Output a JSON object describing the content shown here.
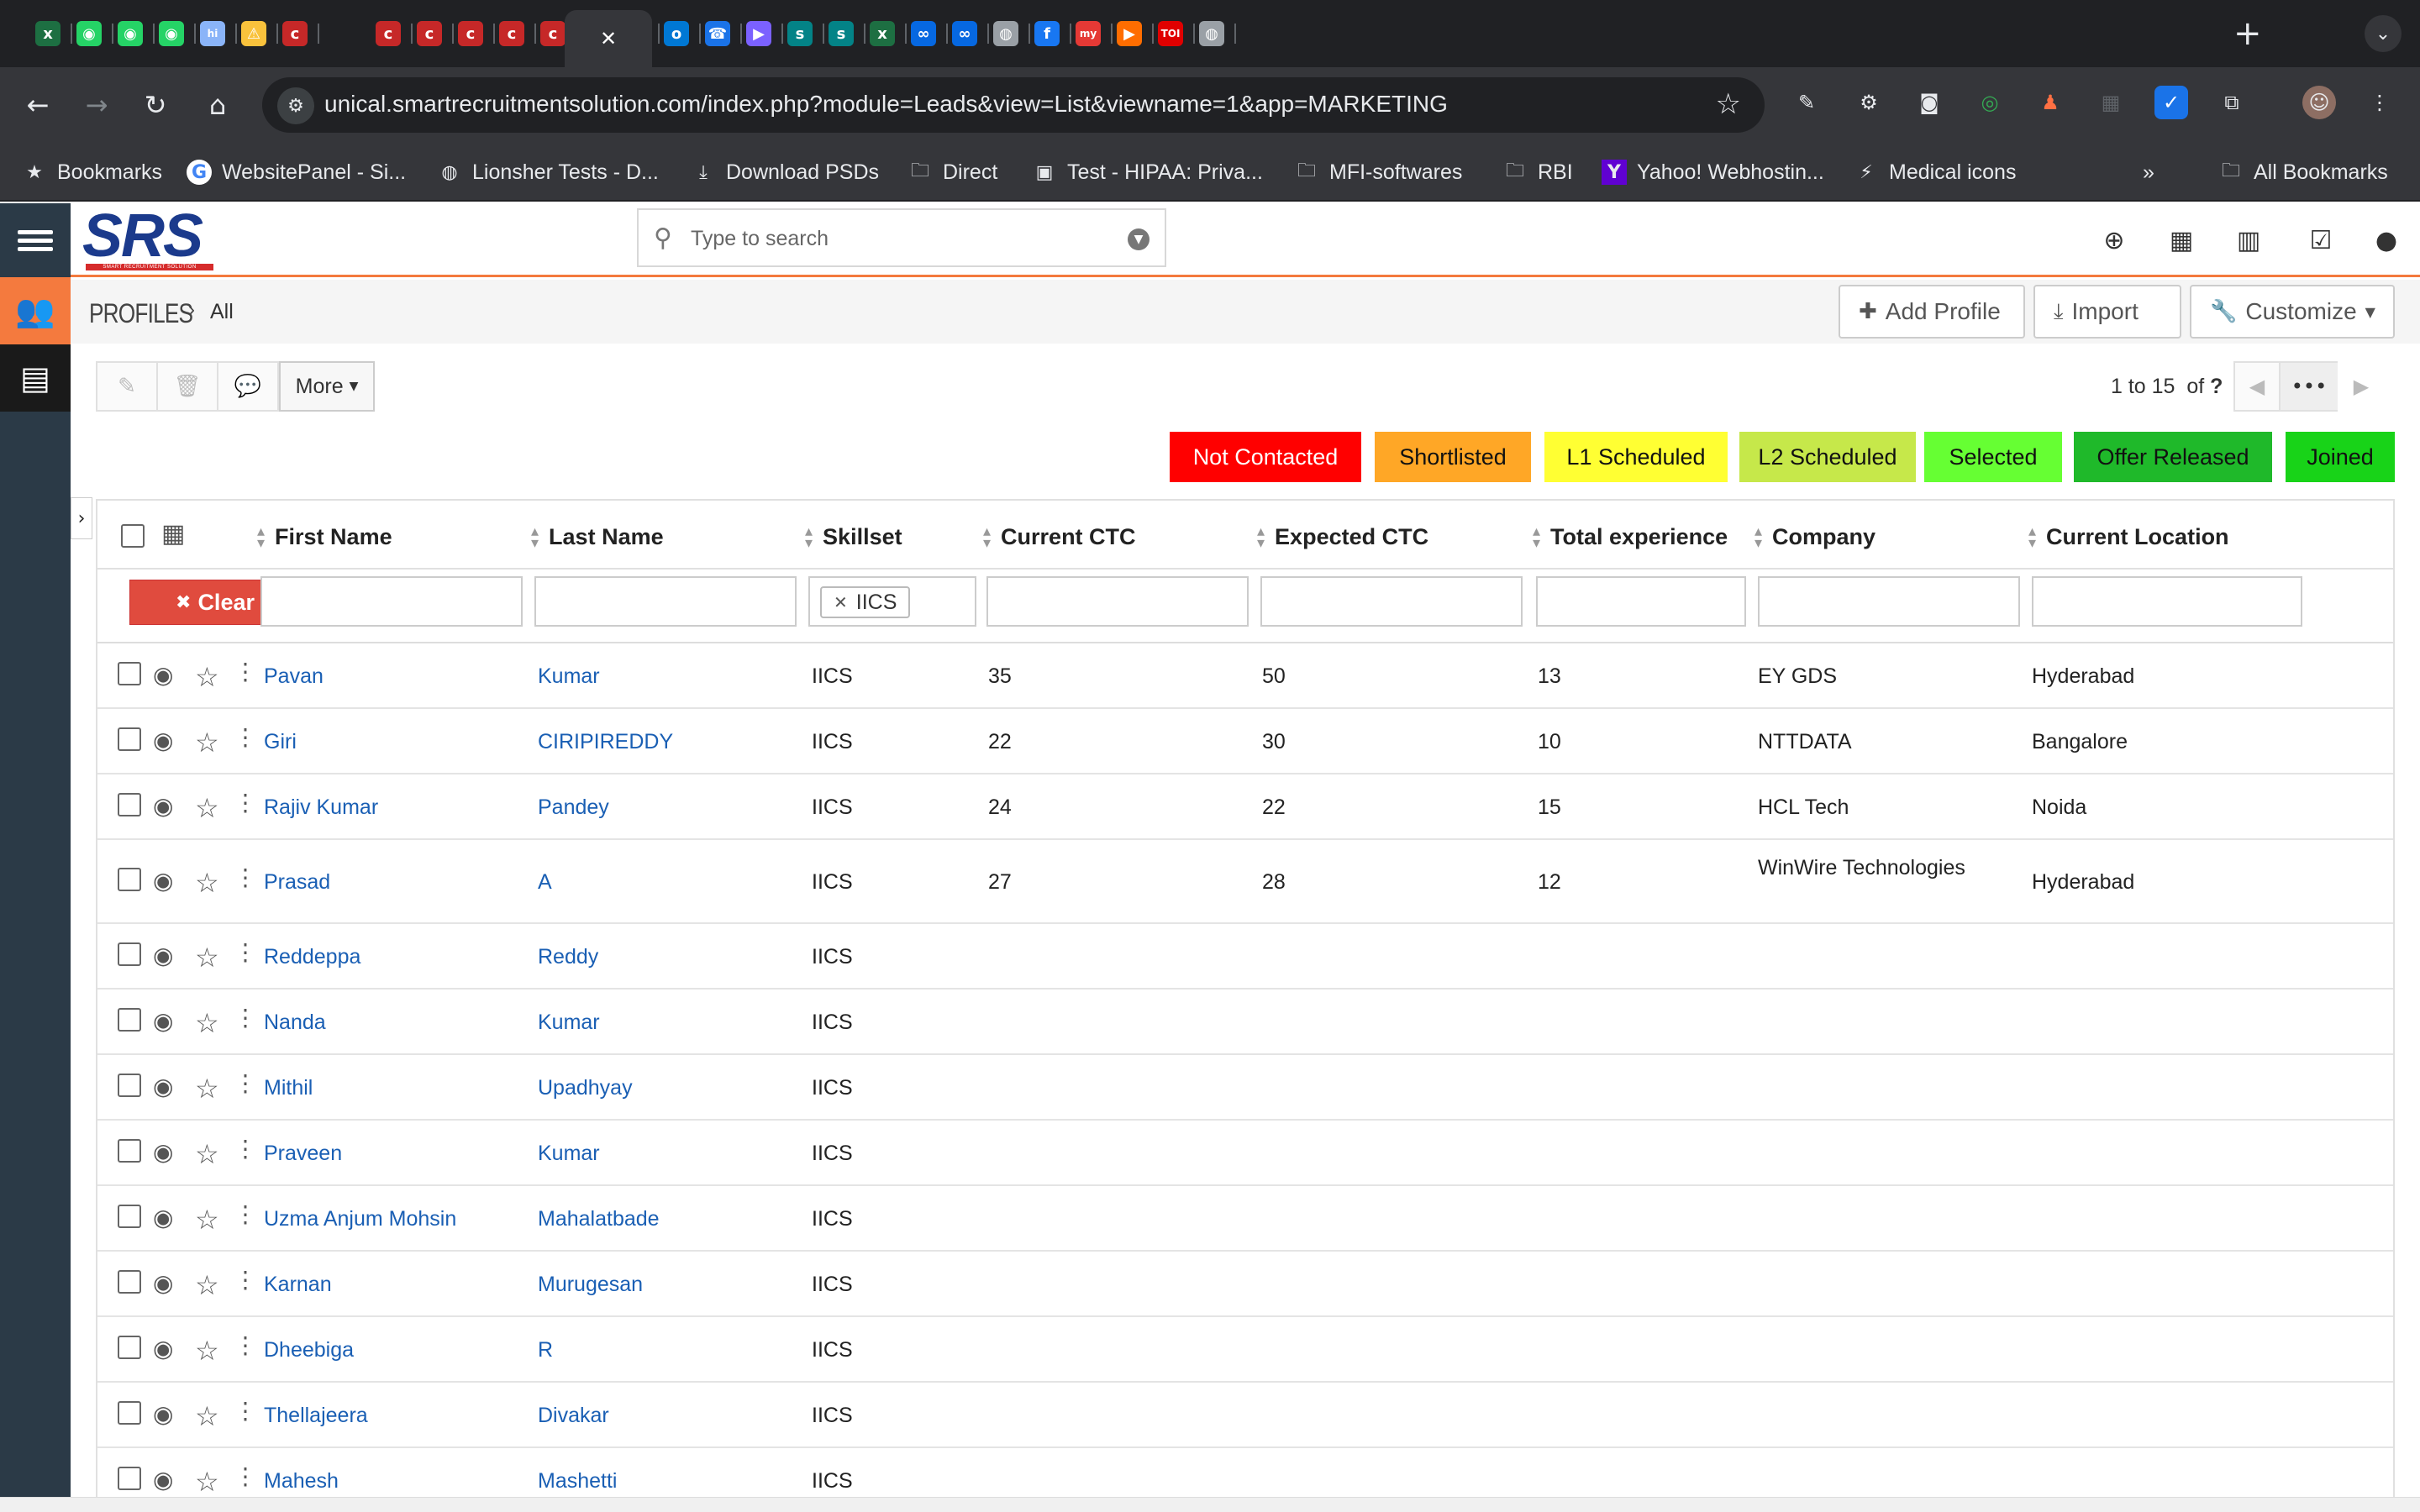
{
  "browser": {
    "tabs": [
      {
        "icon": "excel-icon",
        "glyph": "x",
        "color": "#1d6f42"
      },
      {
        "icon": "whatsapp-icon",
        "glyph": "◉",
        "color": "#25d366"
      },
      {
        "icon": "whatsapp-icon",
        "glyph": "◉",
        "color": "#25d366"
      },
      {
        "icon": "whatsapp-icon",
        "glyph": "◉",
        "color": "#25d366"
      },
      {
        "icon": "hi-icon",
        "glyph": "hi",
        "color": "#8ab4f8"
      },
      {
        "icon": "warning-app-icon",
        "glyph": "⚠",
        "color": "#f9c23c"
      },
      {
        "icon": "unical-icon",
        "glyph": "c",
        "color": "#c62828"
      },
      {
        "icon": "unical-icon",
        "glyph": "c",
        "color": "#c62828"
      },
      {
        "icon": "unical-icon",
        "glyph": "c",
        "color": "#c62828"
      },
      {
        "icon": "unical-icon",
        "glyph": "c",
        "color": "#c62828"
      },
      {
        "icon": "unical-icon",
        "glyph": "c",
        "color": "#c62828"
      },
      {
        "icon": "unical-icon",
        "glyph": "c",
        "color": "#c62828"
      },
      {
        "icon": "gmail-icon",
        "glyph": "M",
        "color": "#ea4335"
      },
      {
        "icon": "globe-green-icon",
        "glyph": "◍",
        "color": "#34a853"
      },
      {
        "icon": "outlook-icon",
        "glyph": "o",
        "color": "#0078d4"
      },
      {
        "icon": "phone-icon",
        "glyph": "☎",
        "color": "#1a73e8"
      },
      {
        "icon": "play-icon",
        "glyph": "▶",
        "color": "#7b61ff"
      },
      {
        "icon": "sharepoint-icon",
        "glyph": "s",
        "color": "#038387"
      },
      {
        "icon": "sharepoint-icon",
        "glyph": "s",
        "color": "#038387"
      },
      {
        "icon": "excel-icon",
        "glyph": "x",
        "color": "#1d6f42"
      },
      {
        "icon": "meta-icon",
        "glyph": "∞",
        "color": "#0668e1"
      },
      {
        "icon": "meta-icon",
        "glyph": "∞",
        "color": "#0668e1"
      },
      {
        "icon": "globe-icon",
        "glyph": "◍",
        "color": "#9aa0a6"
      },
      {
        "icon": "facebook-icon",
        "glyph": "f",
        "color": "#1877f2"
      },
      {
        "icon": "my-icon",
        "glyph": "my",
        "color": "#e53935"
      },
      {
        "icon": "arrow-app-icon",
        "glyph": "▶",
        "color": "#ff6d00"
      },
      {
        "icon": "toi-icon",
        "glyph": "TOI",
        "color": "#e00000"
      },
      {
        "icon": "globe-icon",
        "glyph": "◍",
        "color": "#9aa0a6"
      }
    ],
    "active_tab_close": "✕",
    "new_tab": "+",
    "url": "unical.smartrecruitmentsolution.com/index.php?module=Leads&view=List&viewname=1&app=MARKETING",
    "bookmarks": [
      {
        "icon": "star-icon",
        "glyph": "★",
        "label": "Bookmarks"
      },
      {
        "icon": "google-icon",
        "glyph": "G",
        "label": "WebsitePanel - Si..."
      },
      {
        "icon": "globe-icon",
        "glyph": "◍",
        "label": "Lionsher Tests - D..."
      },
      {
        "icon": "download-icon",
        "glyph": "⤓",
        "label": "Download PSDs"
      },
      {
        "icon": "folder-icon",
        "glyph": "🗀",
        "label": "Direct"
      },
      {
        "icon": "hipaa-icon",
        "glyph": "▣",
        "label": "Test - HIPAA: Priva..."
      },
      {
        "icon": "folder-icon",
        "glyph": "🗀",
        "label": "MFI-softwares"
      },
      {
        "icon": "folder-icon",
        "glyph": "🗀",
        "label": "RBI"
      },
      {
        "icon": "yahoo-icon",
        "glyph": "Y",
        "label": "Yahoo! Webhostin..."
      },
      {
        "icon": "lightning-icon",
        "glyph": "⚡",
        "label": "Medical icons"
      }
    ],
    "more_bookmarks": "»",
    "all_bookmarks": "All Bookmarks"
  },
  "app": {
    "logo_text": "SRS",
    "logo_tagline": "SMART RECRUITMENT SOLUTION",
    "search_placeholder": "Type to search",
    "module": "PROFILES",
    "view": "All",
    "buttons": {
      "add": "Add Profile",
      "import": "Import",
      "customize": "Customize"
    },
    "more": "More",
    "pager": {
      "range": "1 to 15",
      "of": "of",
      "total": "?"
    },
    "statuses": [
      {
        "label": "Not Contacted",
        "color": "#ff0000",
        "text": "#ffffff"
      },
      {
        "label": "Shortlisted",
        "color": "#ffa726",
        "text": "#111111"
      },
      {
        "label": "L1 Scheduled",
        "color": "#ffff33",
        "text": "#111111"
      },
      {
        "label": "L2 Scheduled",
        "color": "#c6e84a",
        "text": "#111111"
      },
      {
        "label": "Selected",
        "color": "#66ff33",
        "text": "#111111"
      },
      {
        "label": "Offer Released",
        "color": "#1fb92a",
        "text": "#111111"
      },
      {
        "label": "Joined",
        "color": "#18d318",
        "text": "#111111"
      }
    ],
    "columns": [
      "First Name",
      "Last Name",
      "Skillset",
      "Current CTC",
      "Expected CTC",
      "Total experience",
      "Company",
      "Current Location"
    ],
    "filter": {
      "clear": "Clear",
      "skillset_chip": "IICS"
    },
    "rows": [
      [
        "Pavan",
        "Kumar",
        "IICS",
        "35",
        "50",
        "13",
        "EY GDS",
        "Hyderabad"
      ],
      [
        "Giri",
        "CIRIPIREDDY",
        "IICS",
        "22",
        "30",
        "10",
        "NTTDATA",
        "Bangalore"
      ],
      [
        "Rajiv Kumar",
        "Pandey",
        "IICS",
        "24",
        "22",
        "15",
        "HCL Tech",
        "Noida"
      ],
      [
        "Prasad",
        "A",
        "IICS",
        "27",
        "28",
        "12",
        "WinWire Technologies",
        "Hyderabad"
      ],
      [
        "Reddeppa",
        "Reddy",
        "IICS",
        "",
        "",
        "",
        "",
        ""
      ],
      [
        "Nanda",
        "Kumar",
        "IICS",
        "",
        "",
        "",
        "",
        ""
      ],
      [
        "Mithil",
        "Upadhyay",
        "IICS",
        "",
        "",
        "",
        "",
        ""
      ],
      [
        "Praveen",
        "Kumar",
        "IICS",
        "",
        "",
        "",
        "",
        ""
      ],
      [
        "Uzma Anjum Mohsin",
        "Mahalatbade",
        "IICS",
        "",
        "",
        "",
        "",
        ""
      ],
      [
        "Karnan",
        "Murugesan",
        "IICS",
        "",
        "",
        "",
        "",
        ""
      ],
      [
        "Dheebiga",
        "R",
        "IICS",
        "",
        "",
        "",
        "",
        ""
      ],
      [
        "Thellajeera",
        "Divakar",
        "IICS",
        "",
        "",
        "",
        "",
        ""
      ],
      [
        "Mahesh",
        "Mashetti",
        "IICS",
        "",
        "",
        "",
        "",
        ""
      ]
    ]
  }
}
